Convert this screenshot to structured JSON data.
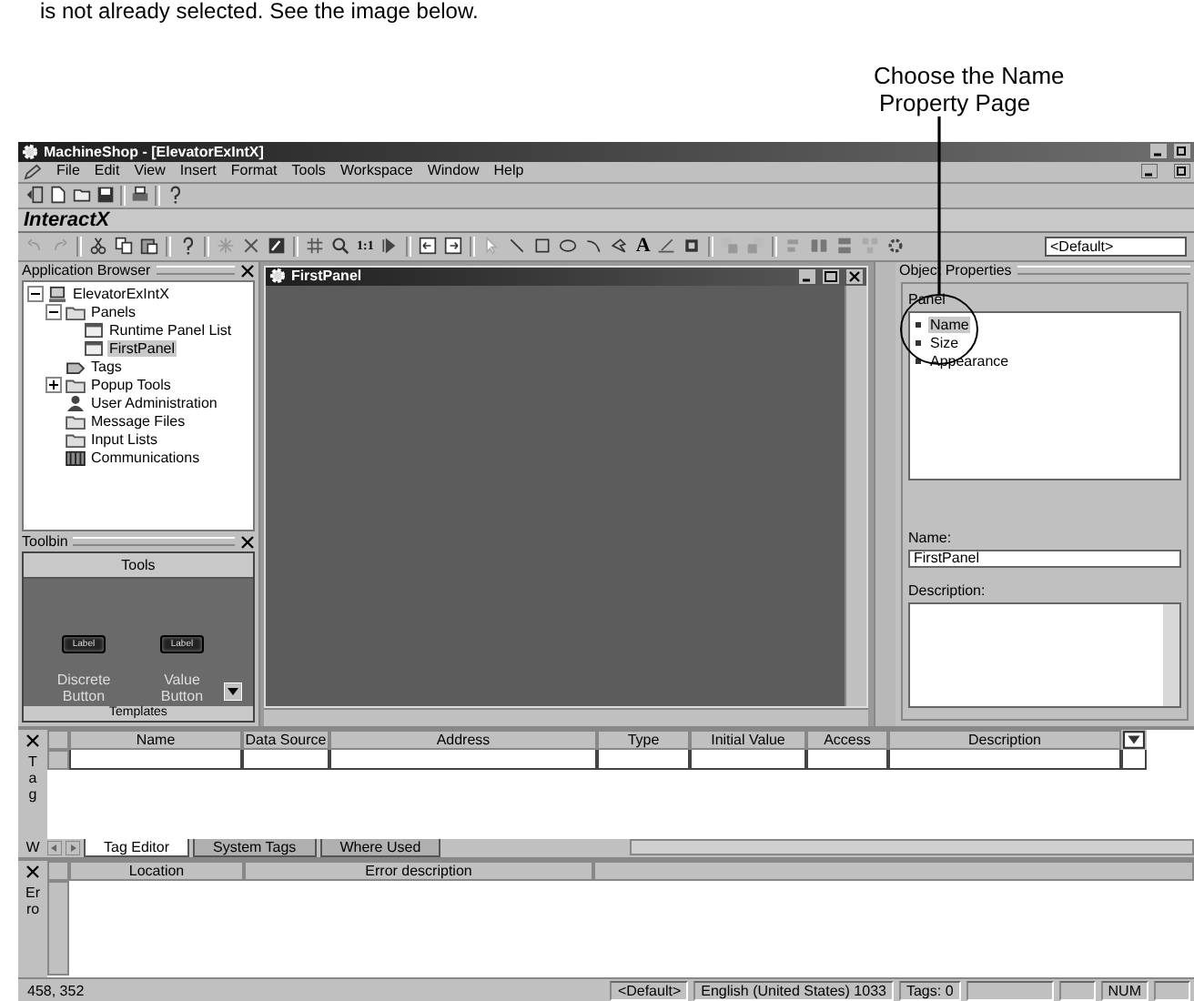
{
  "document": {
    "intro_text": "is not already selected. See the image below.",
    "callout_lines": [
      "Choose the Name",
      "Property Page"
    ]
  },
  "window": {
    "title": "MachineShop - [ElevatorExIntX]"
  },
  "menu": [
    "File",
    "Edit",
    "View",
    "Insert",
    "Format",
    "Tools",
    "Workspace",
    "Window",
    "Help"
  ],
  "brand": "InteractX",
  "toolbar": {
    "zoom_label": "1:1",
    "text_tool": "A",
    "style_combo": "<Default>"
  },
  "app_browser": {
    "title": "Application Browser",
    "tree": [
      {
        "label": "ElevatorExIntX",
        "kind": "project",
        "expanded": true,
        "selected": false,
        "children": [
          {
            "label": "Panels",
            "kind": "folder",
            "expanded": true,
            "selected": false,
            "children": [
              {
                "label": "Runtime Panel List",
                "kind": "panel",
                "selected": false
              },
              {
                "label": "FirstPanel",
                "kind": "panel",
                "selected": true
              }
            ]
          },
          {
            "label": "Tags",
            "kind": "tags",
            "selected": false
          },
          {
            "label": "Popup Tools",
            "kind": "folder",
            "expanded": false,
            "selected": false
          },
          {
            "label": "User Administration",
            "kind": "user",
            "selected": false
          },
          {
            "label": "Message Files",
            "kind": "folder",
            "selected": false
          },
          {
            "label": "Input Lists",
            "kind": "folder",
            "selected": false
          },
          {
            "label": "Communications",
            "kind": "grid",
            "selected": false
          }
        ]
      }
    ]
  },
  "toolbin": {
    "title": "Toolbin",
    "header": "Tools",
    "tools": [
      {
        "label": "Discrete Button",
        "button_text": "Label"
      },
      {
        "label": "Value Button",
        "button_text": "Label"
      }
    ],
    "footer": "Templates"
  },
  "panel_window": {
    "title": "FirstPanel"
  },
  "object_properties": {
    "title": "Object Properties",
    "group": "Panel",
    "pages": [
      {
        "label": "Name",
        "selected": true
      },
      {
        "label": "Size",
        "selected": false
      },
      {
        "label": "Appearance",
        "selected": false
      }
    ],
    "name_label": "Name:",
    "name_value": "FirstPanel",
    "description_label": "Description:"
  },
  "tag_editor": {
    "side_label": "Tag",
    "side_label_cut": "W",
    "columns": [
      "Name",
      "Data Source",
      "Address",
      "Type",
      "Initial Value",
      "Access",
      "Description"
    ],
    "tabs": [
      {
        "label": "Tag Editor",
        "selected": true
      },
      {
        "label": "System Tags",
        "selected": false
      },
      {
        "label": "Where Used",
        "selected": false
      }
    ]
  },
  "error_list": {
    "side_label": "Erro",
    "columns": [
      "Location",
      "Error description"
    ]
  },
  "status_bar": [
    "458, 352",
    "<Default>",
    "English (United States) 1033",
    "Tags: 0",
    "NUM"
  ]
}
